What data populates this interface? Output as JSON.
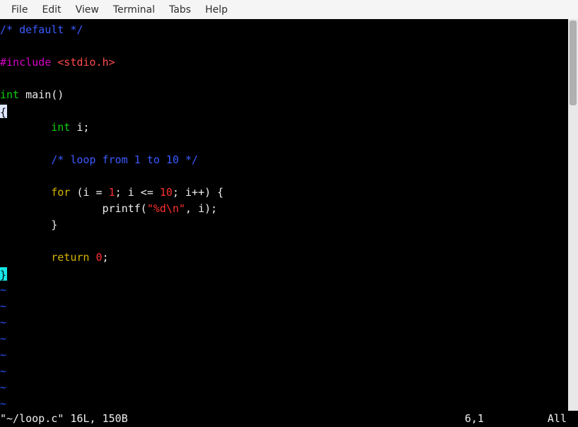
{
  "menubar": {
    "items": [
      "File",
      "Edit",
      "View",
      "Terminal",
      "Tabs",
      "Help"
    ]
  },
  "code": {
    "tokens": [
      [
        {
          "t": "/* default */",
          "c": "c-comment"
        }
      ],
      [],
      [
        {
          "t": "#include",
          "c": "c-preproc"
        },
        {
          "t": " ",
          "c": "c-plain"
        },
        {
          "t": "<stdio.h>",
          "c": "c-header"
        }
      ],
      [],
      [
        {
          "t": "int",
          "c": "c-type"
        },
        {
          "t": " main()",
          "c": "c-plain"
        }
      ],
      [
        {
          "t": "{",
          "c": "cursor"
        }
      ],
      [
        {
          "t": "        ",
          "c": "c-plain"
        },
        {
          "t": "int",
          "c": "c-type"
        },
        {
          "t": " i;",
          "c": "c-plain"
        }
      ],
      [],
      [
        {
          "t": "        ",
          "c": "c-plain"
        },
        {
          "t": "/* loop from 1 to 10 */",
          "c": "c-comment"
        }
      ],
      [],
      [
        {
          "t": "        ",
          "c": "c-plain"
        },
        {
          "t": "for",
          "c": "c-keyword"
        },
        {
          "t": " (i = ",
          "c": "c-plain"
        },
        {
          "t": "1",
          "c": "c-number"
        },
        {
          "t": "; i <= ",
          "c": "c-plain"
        },
        {
          "t": "10",
          "c": "c-number"
        },
        {
          "t": "; i++) {",
          "c": "c-plain"
        }
      ],
      [
        {
          "t": "                printf(",
          "c": "c-plain"
        },
        {
          "t": "\"%d\\n\"",
          "c": "c-string"
        },
        {
          "t": ", i);",
          "c": "c-plain"
        }
      ],
      [
        {
          "t": "        }",
          "c": "c-plain"
        }
      ],
      [],
      [
        {
          "t": "        ",
          "c": "c-plain"
        },
        {
          "t": "return",
          "c": "c-keyword"
        },
        {
          "t": " ",
          "c": "c-plain"
        },
        {
          "t": "0",
          "c": "c-number"
        },
        {
          "t": ";",
          "c": "c-plain"
        }
      ],
      [
        {
          "t": "}",
          "c": "match"
        }
      ]
    ],
    "tilde_count": 8,
    "tilde": "~"
  },
  "status": {
    "left": "\"~/loop.c\" 16L, 150B",
    "mid": "6,1",
    "right": "All"
  }
}
